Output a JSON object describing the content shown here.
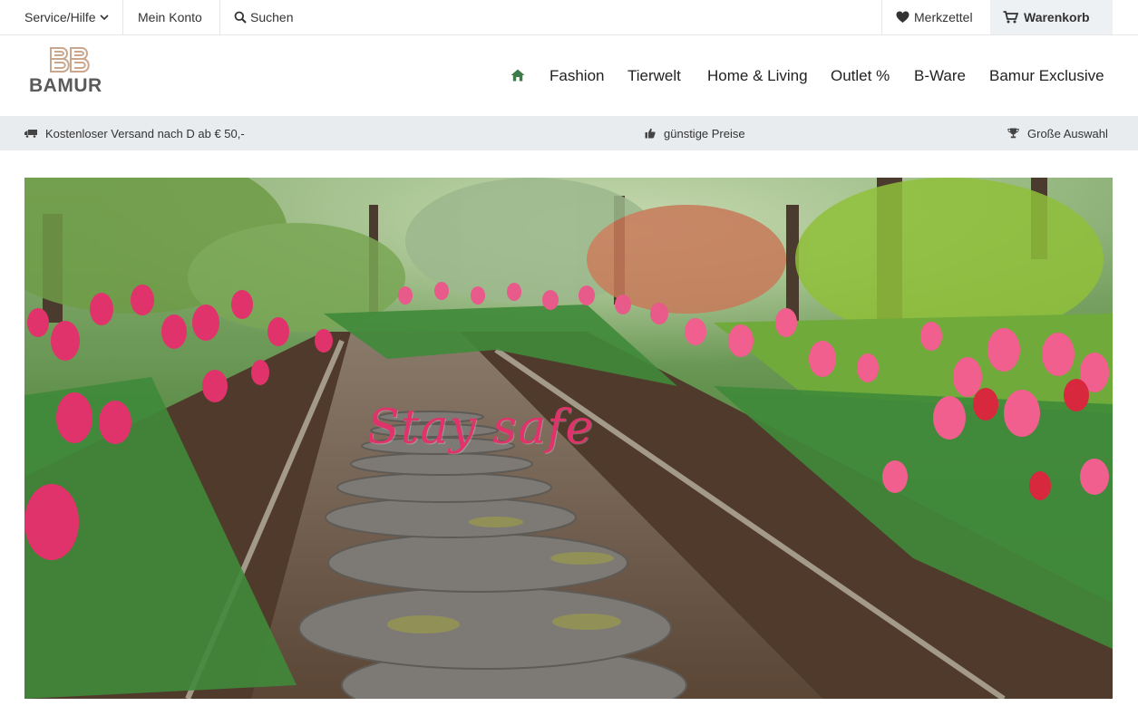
{
  "topbar": {
    "service_label": "Service/Hilfe",
    "account_label": "Mein Konto",
    "search_label": "Suchen",
    "wishlist_label": "Merkzettel",
    "cart_label": "Warenkorb"
  },
  "header": {
    "logo_text": "BAMUR",
    "nav": [
      "Fashion",
      "Tierwelt",
      "Home & Living",
      "Outlet %",
      "B-Ware",
      "Bamur Exclusive"
    ]
  },
  "benefits": {
    "shipping": "Kostenloser Versand nach D ab € 50,-",
    "prices": "günstige Preise",
    "selection": "Große Auswahl"
  },
  "hero": {
    "title": "Stay safe"
  },
  "colors": {
    "accent_green": "#3f7a4a",
    "hero_text": "#e0336b",
    "benefit_bg": "#e9ecef",
    "cart_bg": "#eef1f4"
  },
  "icons": {
    "service": "chevron-down-icon",
    "search": "search-icon",
    "wishlist": "heart-icon",
    "cart": "cart-icon",
    "home": "home-icon",
    "shipping": "truck-icon",
    "prices": "thumbs-up-icon",
    "selection": "trophy-icon"
  }
}
